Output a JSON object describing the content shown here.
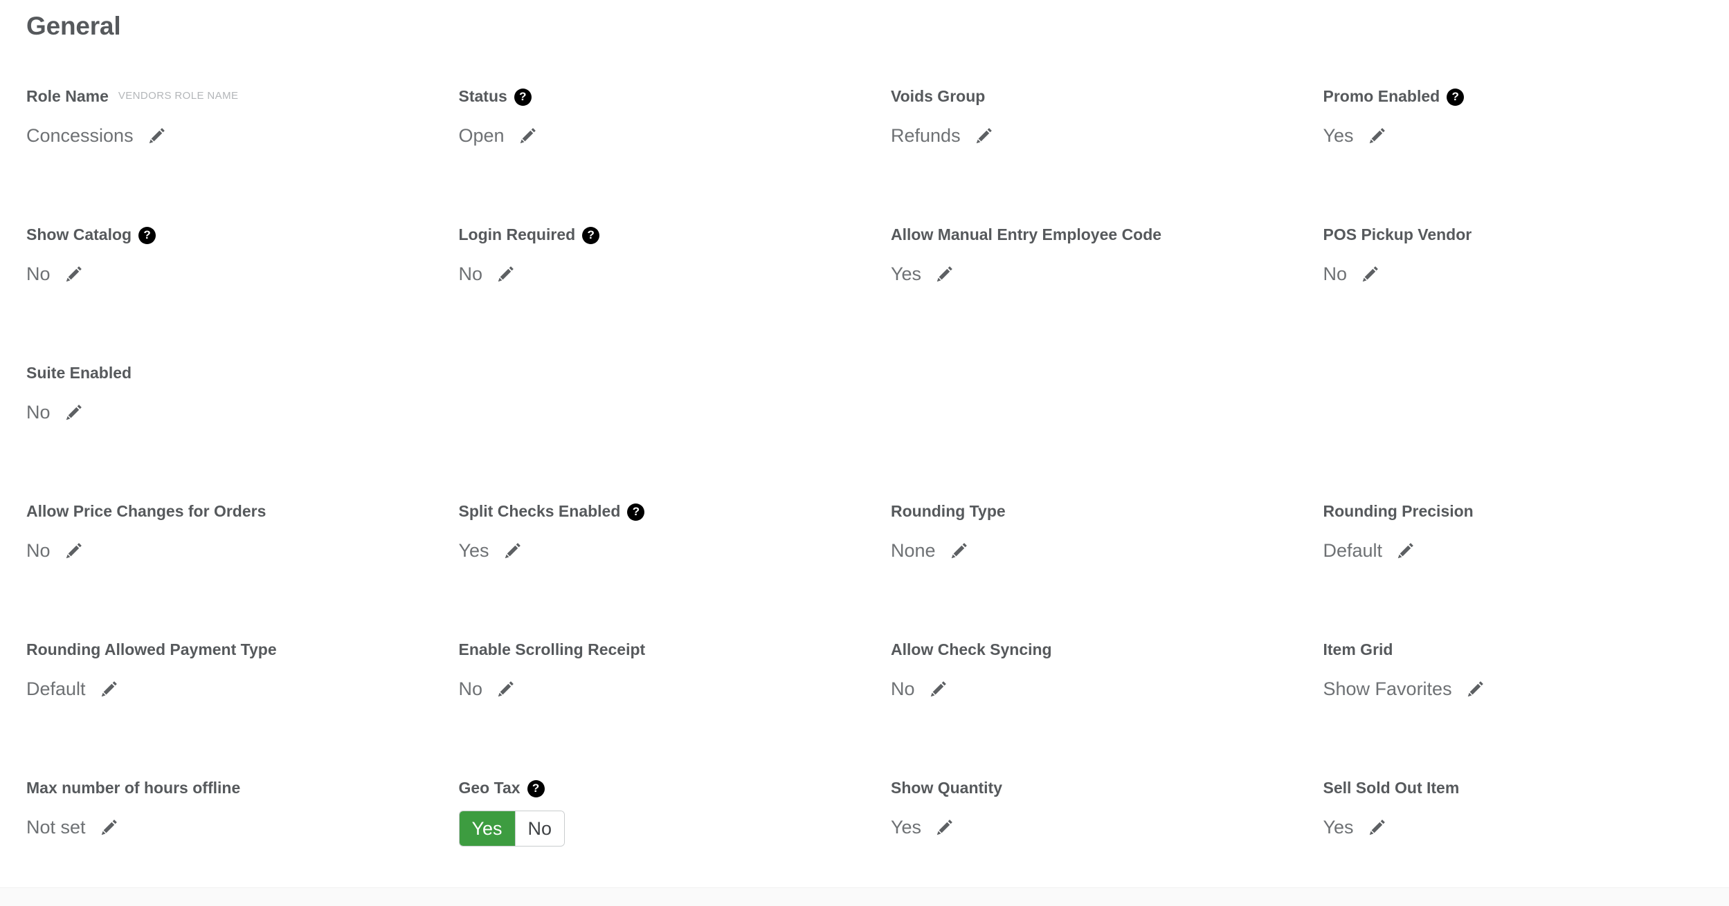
{
  "section": {
    "title": "General"
  },
  "colors": {
    "label": "#56595c",
    "value": "#6e7174",
    "sublabel": "#b3b6b9",
    "toggle_active": "#3d9c40",
    "help_icon": "#000000"
  },
  "icons": {
    "help": "?",
    "edit": "pencil-icon"
  },
  "rows": [
    {
      "cells": [
        {
          "label": "Role Name",
          "sublabel": "VENDORS ROLE NAME",
          "help": false,
          "value": "Concessions",
          "control": "text"
        },
        {
          "label": "Status",
          "sublabel": "",
          "help": true,
          "value": "Open",
          "control": "text"
        },
        {
          "label": "Voids Group",
          "sublabel": "",
          "help": false,
          "value": "Refunds",
          "control": "text"
        },
        {
          "label": "Promo Enabled",
          "sublabel": "",
          "help": true,
          "value": "Yes",
          "control": "text"
        }
      ]
    },
    {
      "cells": [
        {
          "label": "Show Catalog",
          "sublabel": "",
          "help": true,
          "value": "No",
          "control": "text"
        },
        {
          "label": "Login Required",
          "sublabel": "",
          "help": true,
          "value": "No",
          "control": "text"
        },
        {
          "label": "Allow Manual Entry Employee Code",
          "sublabel": "",
          "help": false,
          "value": "Yes",
          "control": "text"
        },
        {
          "label": "POS Pickup Vendor",
          "sublabel": "",
          "help": false,
          "value": "No",
          "control": "text"
        }
      ]
    },
    {
      "cells": [
        {
          "label": "Suite Enabled",
          "sublabel": "",
          "help": false,
          "value": "No",
          "control": "text"
        },
        {
          "label": "",
          "sublabel": "",
          "help": false,
          "value": "",
          "control": "none"
        },
        {
          "label": "",
          "sublabel": "",
          "help": false,
          "value": "",
          "control": "none"
        },
        {
          "label": "",
          "sublabel": "",
          "help": false,
          "value": "",
          "control": "none"
        }
      ]
    },
    {
      "cells": [
        {
          "label": "Allow Price Changes for Orders",
          "sublabel": "",
          "help": false,
          "value": "No",
          "control": "text"
        },
        {
          "label": "Split Checks Enabled",
          "sublabel": "",
          "help": true,
          "value": "Yes",
          "control": "text"
        },
        {
          "label": "Rounding Type",
          "sublabel": "",
          "help": false,
          "value": "None",
          "control": "text"
        },
        {
          "label": "Rounding Precision",
          "sublabel": "",
          "help": false,
          "value": "Default",
          "control": "text"
        }
      ]
    },
    {
      "cells": [
        {
          "label": "Rounding Allowed Payment Type",
          "sublabel": "",
          "help": false,
          "value": "Default",
          "control": "text"
        },
        {
          "label": "Enable Scrolling Receipt",
          "sublabel": "",
          "help": false,
          "value": "No",
          "control": "text"
        },
        {
          "label": "Allow Check Syncing",
          "sublabel": "",
          "help": false,
          "value": "No",
          "control": "text"
        },
        {
          "label": "Item Grid",
          "sublabel": "",
          "help": false,
          "value": "Show Favorites",
          "control": "text"
        }
      ]
    },
    {
      "cells": [
        {
          "label": "Max number of hours offline",
          "sublabel": "",
          "help": false,
          "value": "Not set",
          "control": "text"
        },
        {
          "label": "Geo Tax",
          "sublabel": "",
          "help": true,
          "value": "Yes",
          "control": "toggle",
          "options": [
            "Yes",
            "No"
          ],
          "selected": "Yes"
        },
        {
          "label": "Show Quantity",
          "sublabel": "",
          "help": false,
          "value": "Yes",
          "control": "text"
        },
        {
          "label": "Sell Sold Out Item",
          "sublabel": "",
          "help": false,
          "value": "Yes",
          "control": "text"
        }
      ]
    }
  ]
}
